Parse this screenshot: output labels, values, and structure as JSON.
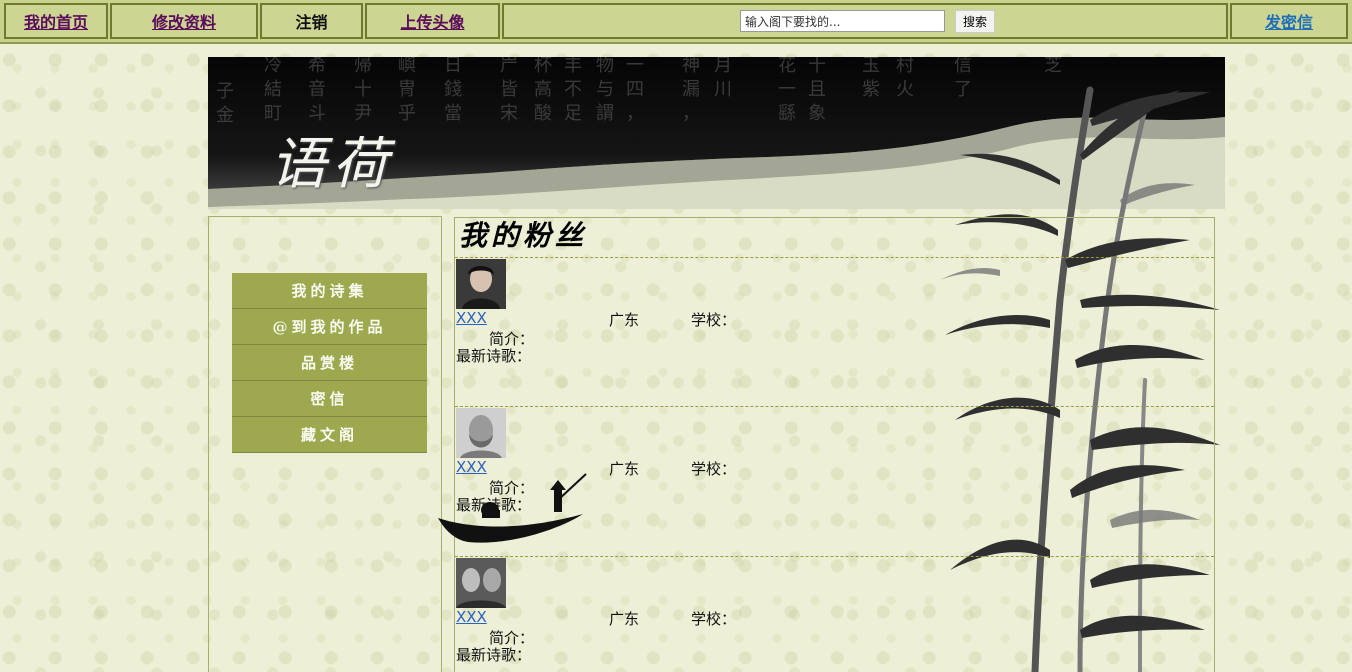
{
  "nav": {
    "home": "我的首页",
    "edit_profile": "修改资料",
    "logout": "注销",
    "upload_avatar": "上传头像",
    "search_placeholder": "输入阁下要找的...",
    "search_button": "搜索",
    "send_message": "发密信"
  },
  "banner": {
    "logo_text": "语荷"
  },
  "sidebar": {
    "items": [
      {
        "label": "我的诗集"
      },
      {
        "label": "@到我的作品"
      },
      {
        "label": "品赏楼"
      },
      {
        "label": "密信"
      },
      {
        "label": "藏文阁"
      }
    ]
  },
  "main": {
    "title": "我的粉丝",
    "fans": [
      {
        "name": "XXX",
        "province": "广东",
        "school_label": "学校：",
        "intro_label": "简介：",
        "latest_label": "最新诗歌："
      },
      {
        "name": "XXX",
        "province": "广东",
        "school_label": "学校：",
        "intro_label": "简介：",
        "latest_label": "最新诗歌："
      },
      {
        "name": "XXX",
        "province": "广东",
        "school_label": "学校：",
        "intro_label": "简介：",
        "latest_label": "最新诗歌："
      }
    ]
  },
  "colors": {
    "nav_bg": "#c9d28c",
    "menu_bg": "#9da84f",
    "page_bg": "#edefd6",
    "link_purple": "#5b0b5b",
    "link_blue": "#2a61c4"
  },
  "icons": [
    "avatar-photo",
    "bamboo-painting",
    "boat-silhouette"
  ]
}
